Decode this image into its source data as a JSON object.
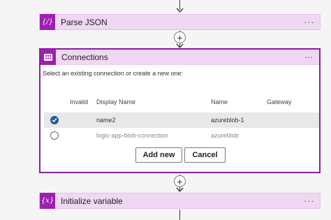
{
  "steps": {
    "parse_json": {
      "title": "Parse JSON",
      "icon": "{/}",
      "more": "···"
    },
    "connections": {
      "title": "Connections",
      "more": "···",
      "prompt": "Select an existing connection or create a new one:",
      "columns": {
        "invalid": "Invalid",
        "display_name": "Display Name",
        "name": "Name",
        "gateway": "Gateway"
      },
      "rows": [
        {
          "display_name": "name2",
          "name": "azureblob-1",
          "gateway": "",
          "selected": true
        },
        {
          "display_name": "logic-app-blob-connection",
          "name": "azureblob",
          "gateway": "",
          "selected": false
        }
      ],
      "add_new_label": "Add new",
      "cancel_label": "Cancel"
    },
    "initialize_variable": {
      "title": "Initialize variable",
      "icon": "{x}",
      "more": "···"
    }
  },
  "add_step_symbol": "+",
  "colors": {
    "card_bg": "#f0d7f3",
    "icon_bg": "#9e1fb2",
    "selected_border": "#8a1fa0",
    "selected_radio": "#2b5797"
  }
}
